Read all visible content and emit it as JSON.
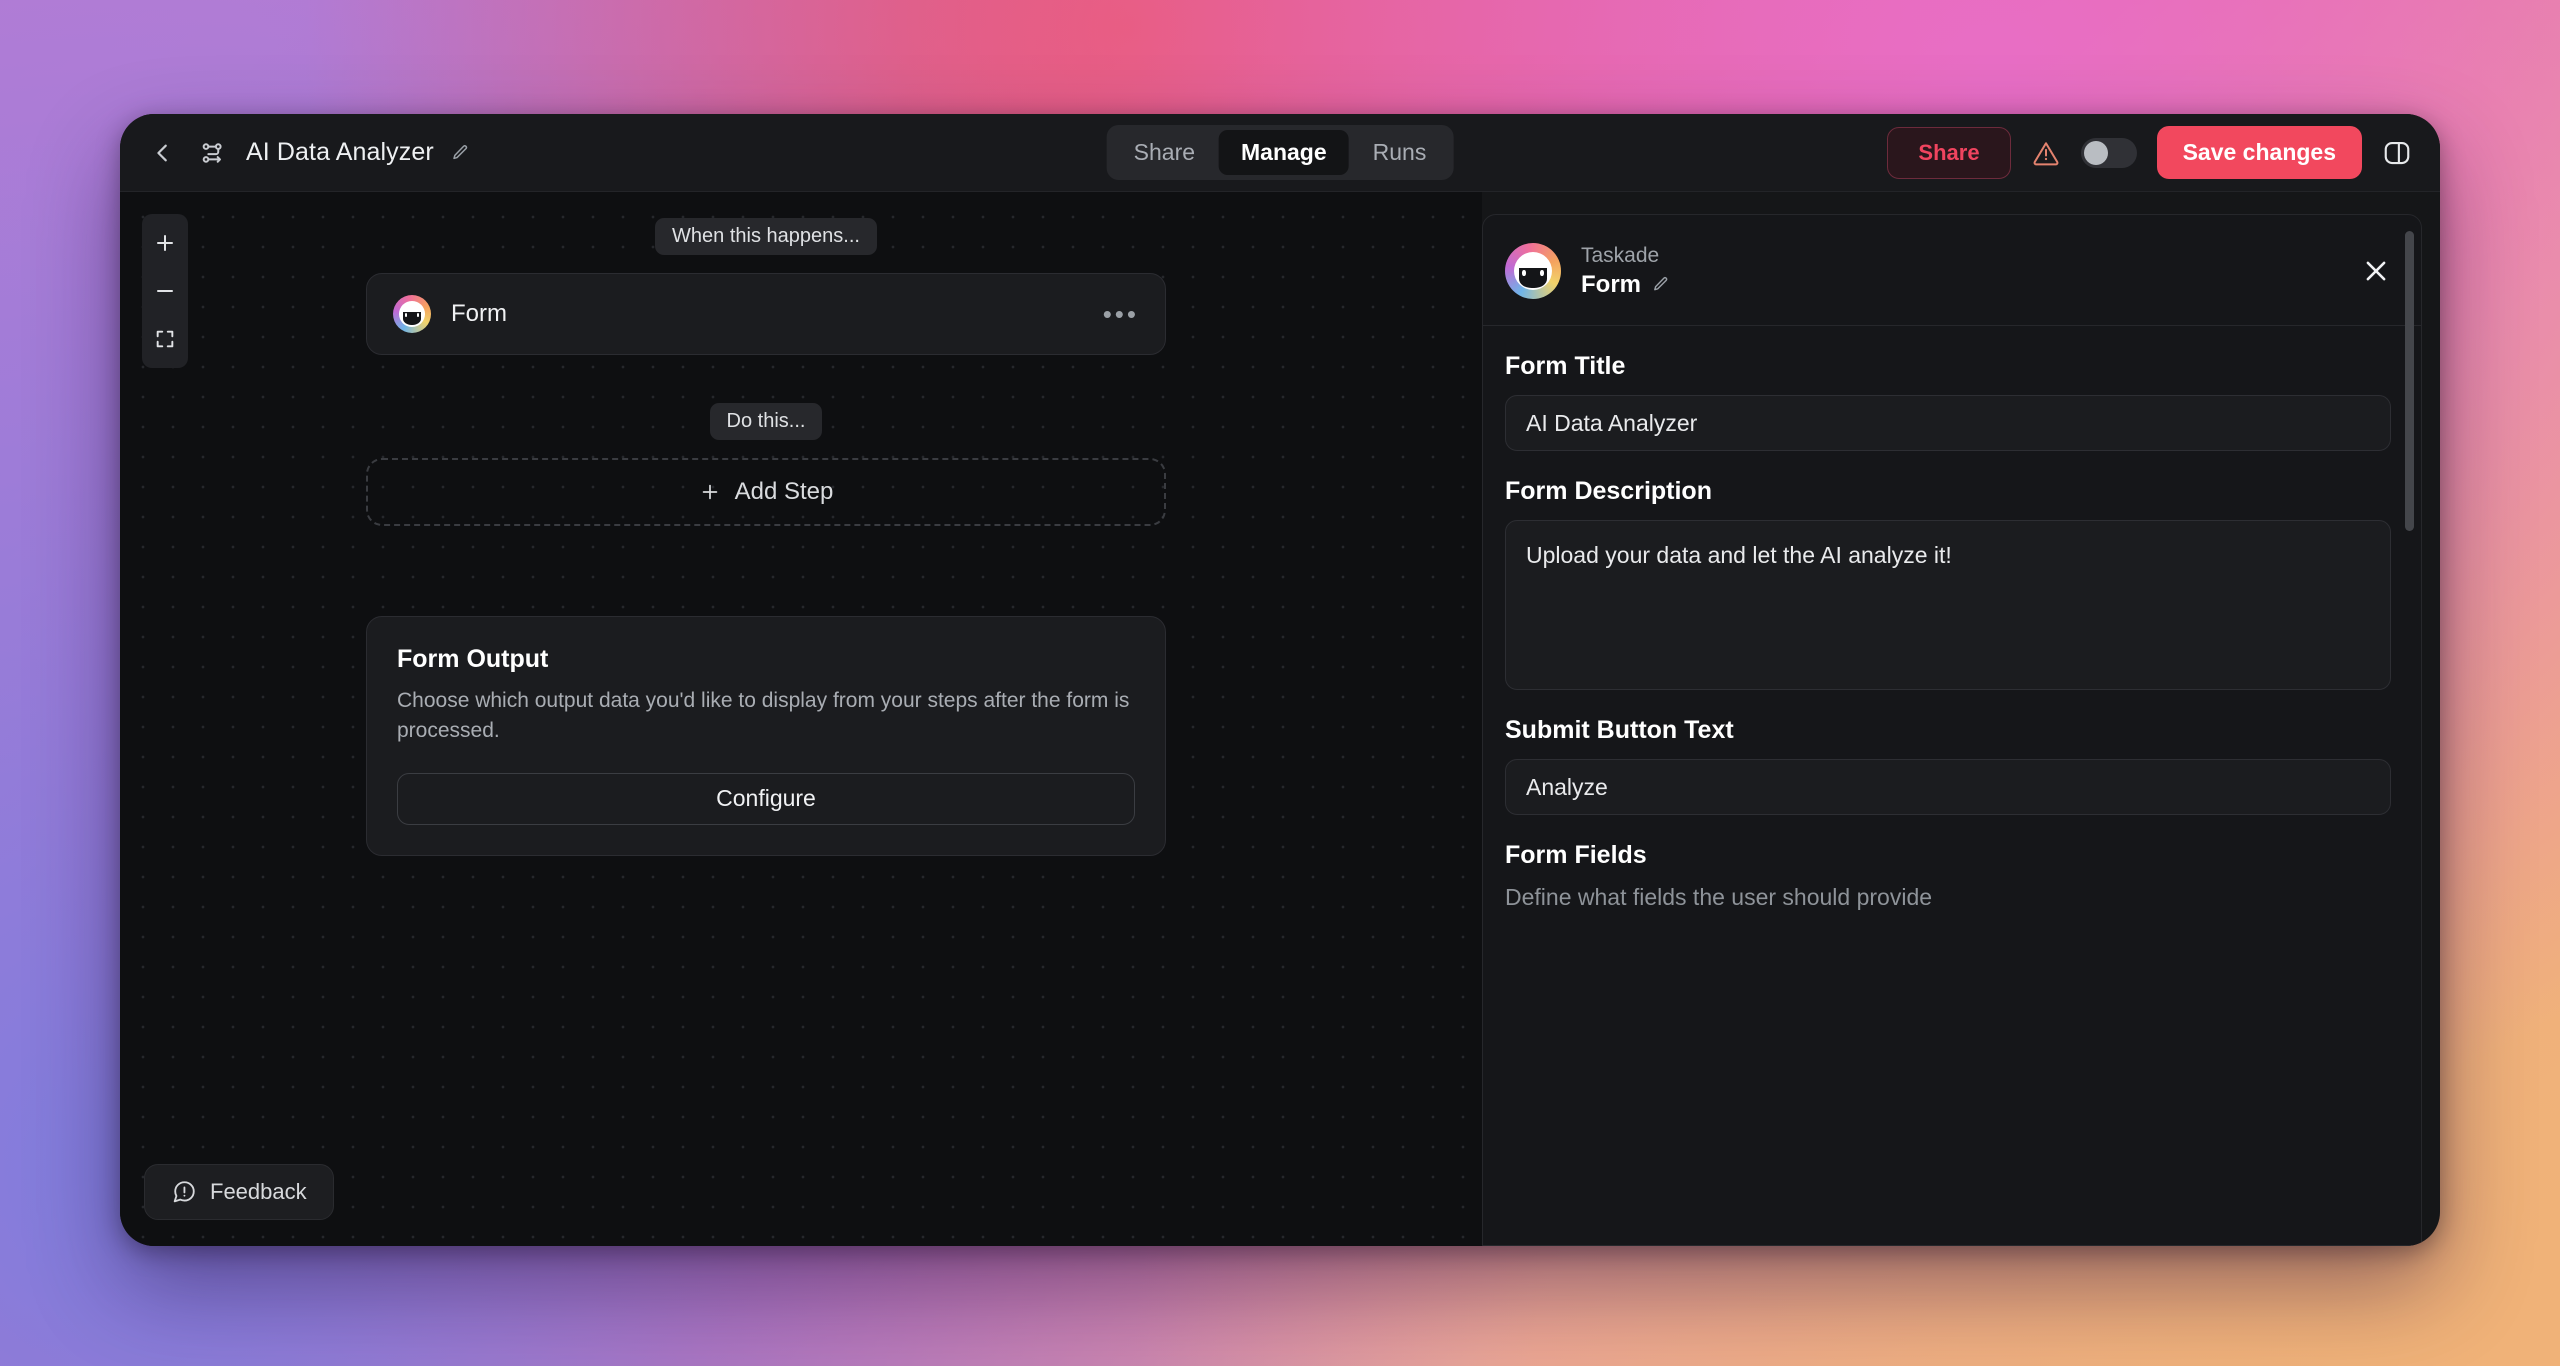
{
  "window": {
    "header": {
      "back_icon": "chevron-left-icon",
      "flow_icon": "workflow-icon",
      "title": "AI Data Analyzer",
      "edit_icon": "pencil-icon",
      "tabs": [
        {
          "label": "Share",
          "active": false
        },
        {
          "label": "Manage",
          "active": true
        },
        {
          "label": "Runs",
          "active": false
        }
      ],
      "share_button": "Share",
      "warning_icon": "warning-triangle-icon",
      "toggle_state": "off",
      "save_button": "Save changes",
      "panel_toggle_icon": "right-panel-toggle-icon"
    },
    "canvas": {
      "zoom_controls": {
        "zoom_in": "+",
        "zoom_out": "–",
        "fit_screen_icon": "fit-to-screen-icon"
      },
      "trigger_chip": "When this happens...",
      "trigger_node": {
        "label": "Form",
        "logo": "taskade-logo-icon",
        "more_icon": "more-options-icon"
      },
      "action_chip": "Do this...",
      "add_step": {
        "plus": "+",
        "label": "Add Step"
      },
      "form_output": {
        "title": "Form Output",
        "description": "Choose which output data you'd like to display from your steps after the form is processed.",
        "button": "Configure"
      },
      "feedback": {
        "icon": "feedback-bubble-icon",
        "label": "Feedback"
      }
    },
    "panel": {
      "app_name": "Taskade",
      "node_name": "Form",
      "edit_icon": "pencil-icon",
      "close_icon": "close-icon",
      "logo": "taskade-logo-icon",
      "fields": {
        "form_title_label": "Form Title",
        "form_title_value": "AI Data Analyzer",
        "form_description_label": "Form Description",
        "form_description_value": "Upload your data and let the AI analyze it!",
        "submit_button_label": "Submit Button Text",
        "submit_button_value": "Analyze",
        "form_fields_label": "Form Fields",
        "form_fields_note": "Define what fields the user should provide"
      }
    }
  },
  "colors": {
    "accent_red": "#f2485e",
    "window_bg": "#151618",
    "canvas_bg": "#0e0f11",
    "panel_bg": "#151619"
  }
}
